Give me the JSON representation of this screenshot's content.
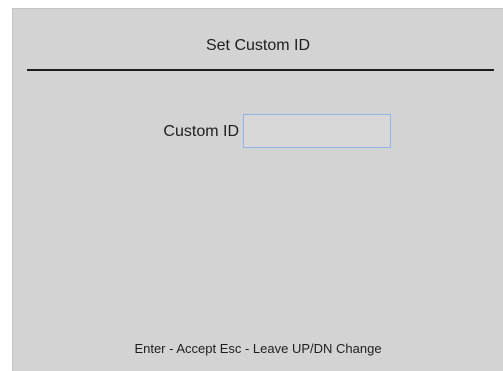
{
  "dialog": {
    "title": "Set Custom ID"
  },
  "field": {
    "label": "Custom ID",
    "value": "",
    "placeholder": ""
  },
  "footer": {
    "help_text": "Enter - Accept Esc - Leave UP/DN Change"
  },
  "colors": {
    "panel_background": "#d3d3d3",
    "input_border": "#8db4e8",
    "divider": "#1c1c1c"
  }
}
